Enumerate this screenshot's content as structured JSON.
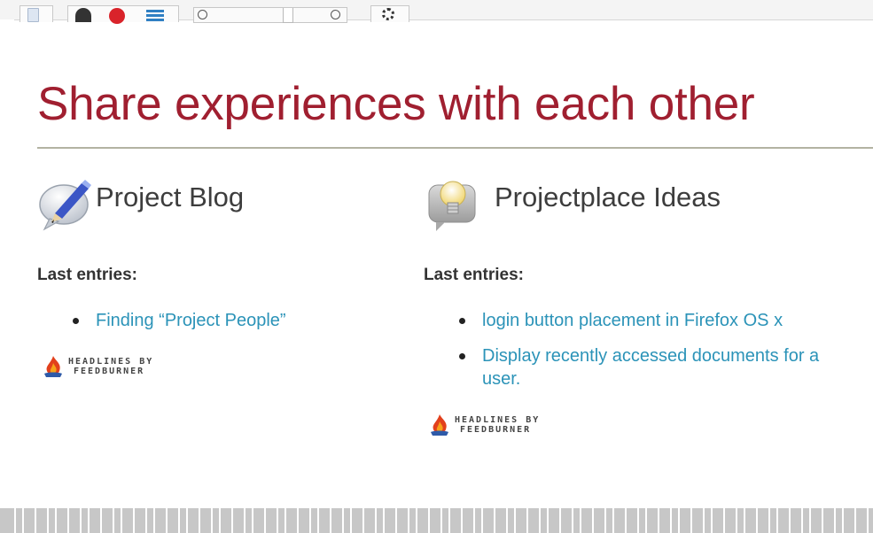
{
  "page": {
    "title": "Share experiences with each other"
  },
  "toolbar": {
    "icons": [
      "page-icon",
      "back-icon",
      "stop-icon",
      "list-icon",
      "zoom-out-icon",
      "zoom-in-icon",
      "settings-icon"
    ]
  },
  "sections": [
    {
      "heading": "Project Blog",
      "icon": "pencil-speech-bubble-icon",
      "last_entries_label": "Last entries:",
      "entries": [
        "Finding “Project People”"
      ],
      "feed_line1": "HEADLINES BY",
      "feed_line2": "FEEDBURNER"
    },
    {
      "heading": "Projectplace Ideas",
      "icon": "lightbulb-speech-bubble-icon",
      "last_entries_label": "Last entries:",
      "entries": [
        "login button placement in Firefox OS x",
        "Display recently accessed documents for a user."
      ],
      "feed_line1": "HEADLINES BY",
      "feed_line2": "FEEDBURNER"
    }
  ],
  "colors": {
    "title": "#a01f30",
    "link": "#2b93b8",
    "heading": "#3d3d3d",
    "rule": "#b3b3a2"
  }
}
